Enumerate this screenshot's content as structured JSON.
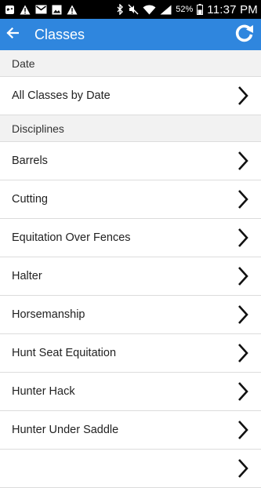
{
  "statusbar": {
    "battery_percent": "52%",
    "time": "11:37 PM"
  },
  "appbar": {
    "title": "Classes",
    "back_icon": "arrow-left-icon",
    "refresh_icon": "refresh-icon"
  },
  "sections": [
    {
      "header": "Date",
      "items": [
        "All Classes by Date"
      ]
    },
    {
      "header": "Disciplines",
      "items": [
        "Barrels",
        "Cutting",
        "Equitation Over Fences",
        "Halter",
        "Horsemanship",
        "Hunt Seat Equitation",
        "Hunter Hack",
        "Hunter Under Saddle"
      ]
    }
  ],
  "colors": {
    "appbar": "#2f86de",
    "section_bg": "#f2f2f2"
  }
}
